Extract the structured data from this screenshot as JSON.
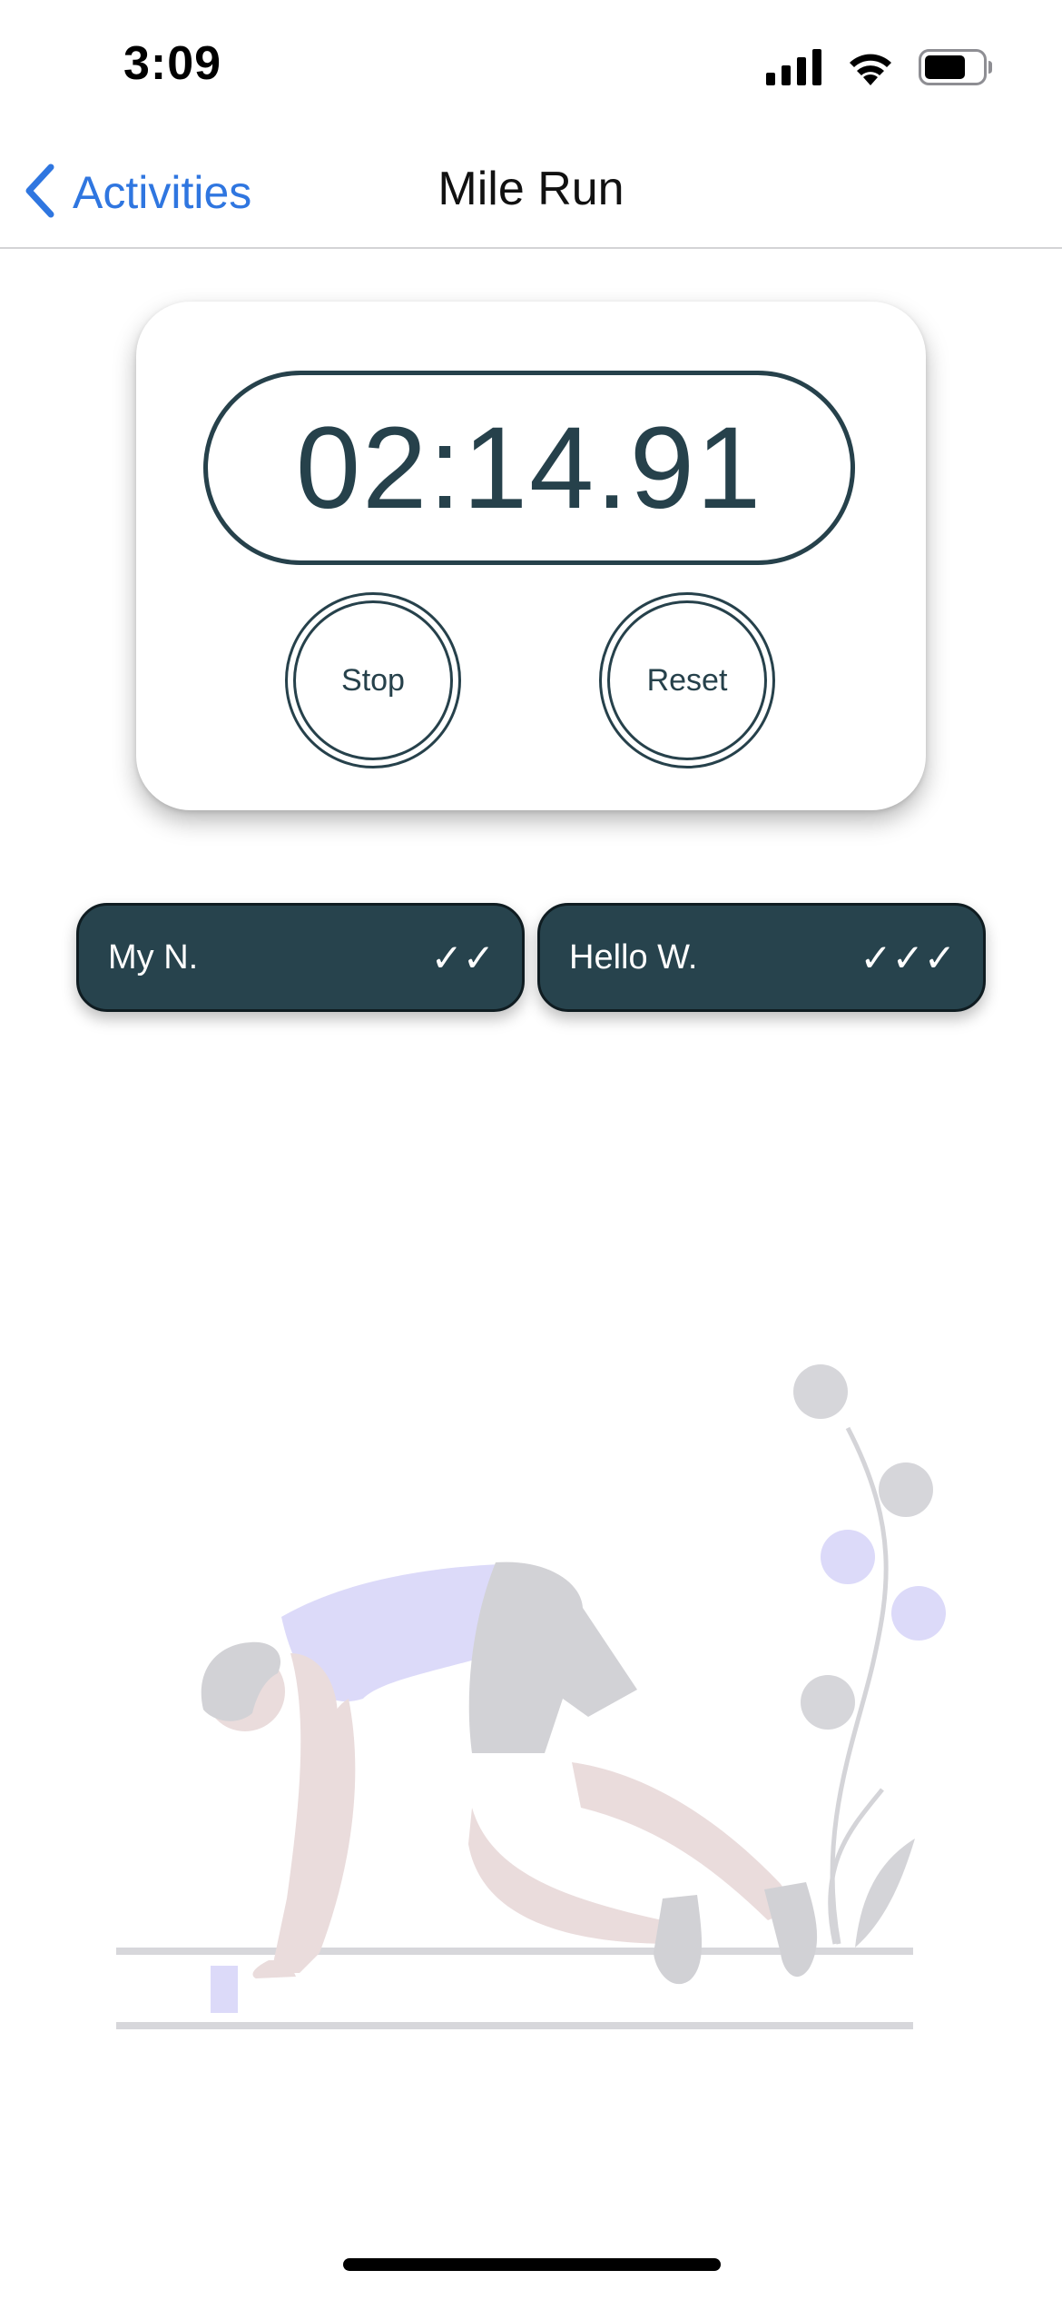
{
  "status_bar": {
    "time": "3:09",
    "icons": [
      "cellular-signal-icon",
      "wifi-icon",
      "battery-icon"
    ]
  },
  "nav": {
    "back_label": "Activities",
    "back_icon": "chevron-left-icon",
    "title": "Mile Run"
  },
  "timer": {
    "display": "02:14.91",
    "stop_label": "Stop",
    "reset_label": "Reset"
  },
  "splits": [
    {
      "name": "My N.",
      "marks": "✓✓"
    },
    {
      "name": "Hello W.",
      "marks": "✓✓✓"
    }
  ],
  "illustration": {
    "icon": "runner-starting-blocks-illustration"
  },
  "colors": {
    "accent_blue": "#2f76e0",
    "dark_teal": "#26414b",
    "chip_bg": "#27434d",
    "illustration_gray": "#d4d4d8",
    "illustration_lavender": "#dcdaf9",
    "illustration_pink": "#eadcdc"
  }
}
